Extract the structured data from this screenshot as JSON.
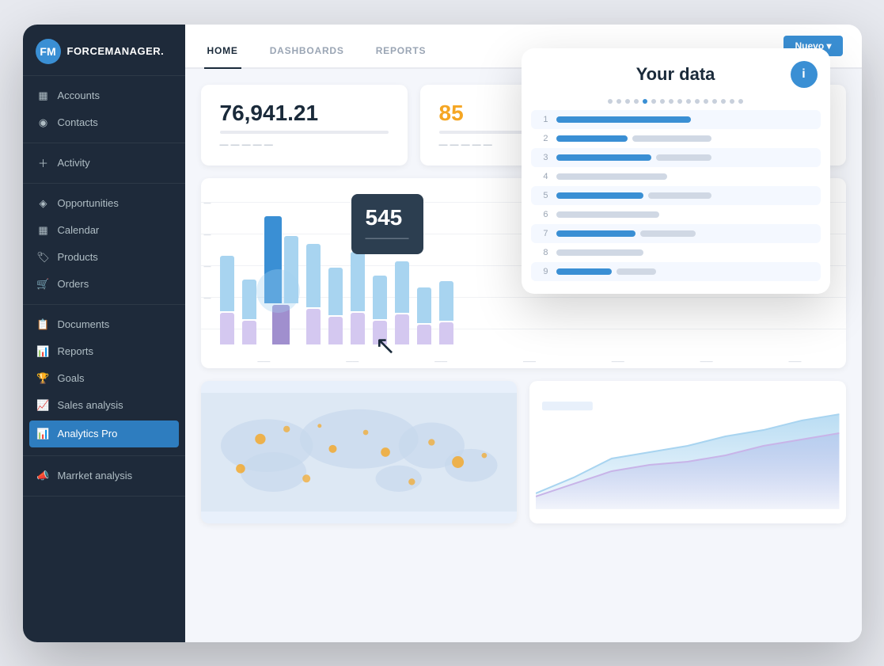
{
  "logo": {
    "icon": "FM",
    "text": "FORCEMANAGER."
  },
  "sidebar": {
    "sections": [
      {
        "items": [
          {
            "label": "Accounts",
            "icon": "▦",
            "active": false
          },
          {
            "label": "Contacts",
            "icon": "👤",
            "active": false
          }
        ]
      },
      {
        "items": [
          {
            "label": "Activity",
            "icon": "+",
            "active": false,
            "add": true
          }
        ]
      },
      {
        "items": [
          {
            "label": "Opportunities",
            "icon": "◈",
            "active": false
          },
          {
            "label": "Calendar",
            "icon": "▦",
            "active": false
          },
          {
            "label": "Products",
            "icon": "🏷",
            "active": false
          },
          {
            "label": "Orders",
            "icon": "🛒",
            "active": false
          }
        ]
      },
      {
        "items": [
          {
            "label": "Documents",
            "icon": "📋",
            "active": false
          },
          {
            "label": "Reports",
            "icon": "📊",
            "active": false
          },
          {
            "label": "Goals",
            "icon": "🏆",
            "active": false
          },
          {
            "label": "Sales analysis",
            "icon": "📈",
            "active": false
          },
          {
            "label": "Analytics Pro",
            "icon": "📊",
            "active": true
          }
        ]
      },
      {
        "items": [
          {
            "label": "Marrket analysis",
            "icon": "📣",
            "active": false
          }
        ]
      }
    ]
  },
  "header": {
    "tabs": [
      {
        "label": "HOME",
        "active": true
      },
      {
        "label": "DASHBOARDS",
        "active": false
      },
      {
        "label": "REPORTS",
        "active": false
      }
    ],
    "button": "Nuevo ▾"
  },
  "stats": [
    {
      "value": "76,941.21",
      "orange": false
    },
    {
      "value": "85",
      "orange": true
    }
  ],
  "tooltip": {
    "value": "545",
    "sub": "—————"
  },
  "popup": {
    "title": "Your data",
    "info_label": "i",
    "dots": [
      false,
      false,
      false,
      false,
      true,
      false,
      false,
      false,
      false,
      false,
      false,
      false,
      false,
      false,
      false,
      false
    ],
    "rows": [
      {
        "num": "1",
        "blue_w": 160,
        "gray_w": 0
      },
      {
        "num": "2",
        "blue_w": 90,
        "gray_w": 120
      },
      {
        "num": "3",
        "blue_w": 120,
        "gray_w": 80
      },
      {
        "num": "4",
        "blue_w": 0,
        "gray_w": 140
      },
      {
        "num": "5",
        "blue_w": 110,
        "gray_w": 90
      },
      {
        "num": "6",
        "blue_w": 0,
        "gray_w": 130
      },
      {
        "num": "7",
        "blue_w": 100,
        "gray_w": 80
      },
      {
        "num": "8",
        "blue_w": 0,
        "gray_w": 110
      },
      {
        "num": "9",
        "blue_w": 70,
        "gray_w": 50
      }
    ]
  },
  "chart": {
    "x_labels": [
      "",
      "",
      "",
      "",
      "",
      "",
      "",
      "",
      "",
      ""
    ]
  }
}
